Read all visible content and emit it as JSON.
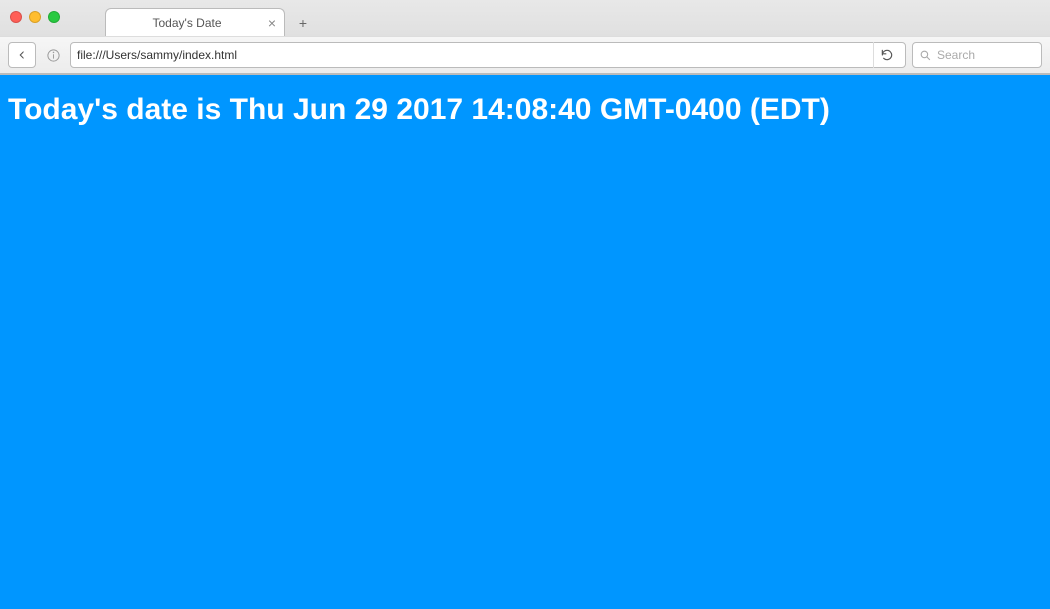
{
  "window": {
    "tab_title": "Today's Date"
  },
  "toolbar": {
    "url": "file:///Users/sammy/index.html",
    "search_placeholder": "Search"
  },
  "page": {
    "heading": "Today's date is Thu Jun 29 2017 14:08:40 GMT-0400 (EDT)"
  }
}
